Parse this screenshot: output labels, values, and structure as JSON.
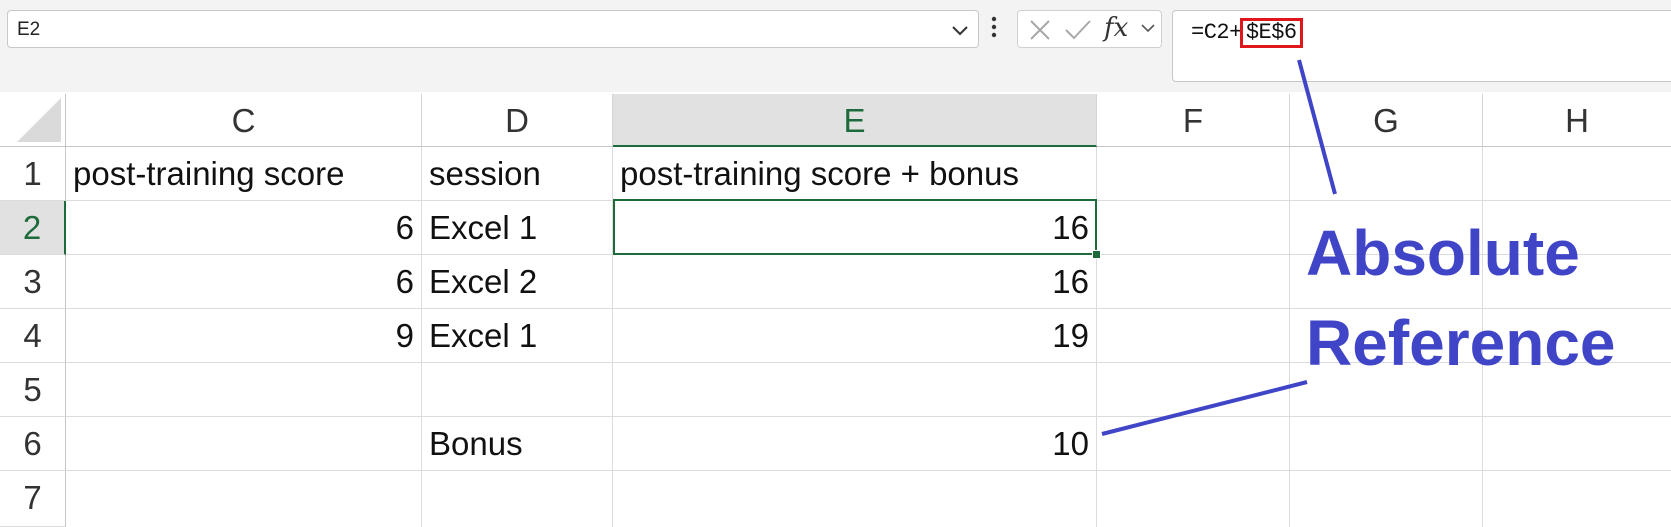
{
  "name_box": {
    "value": "E2"
  },
  "formula_bar": {
    "prefix": "=C2+",
    "highlighted_ref": "$E$6",
    "fx_label": "fx"
  },
  "columns": [
    "C",
    "D",
    "E",
    "F",
    "G",
    "H"
  ],
  "selected_column": "E",
  "rows": [
    "1",
    "2",
    "3",
    "4",
    "5",
    "6",
    "7"
  ],
  "selected_row": "2",
  "cells": {
    "C1": "post-training score",
    "D1": "session",
    "E1": "post-training score + bonus",
    "C2": "6",
    "D2": "Excel 1",
    "E2": "16",
    "C3": "6",
    "D3": "Excel 2",
    "E3": "16",
    "C4": "9",
    "D4": "Excel 1",
    "E4": "19",
    "D6": "Bonus",
    "E6": "10"
  },
  "annotation": {
    "line1": "Absolute",
    "line2": "Reference",
    "color": "#4045c8",
    "highlight_color": "#e0161d"
  },
  "colors": {
    "selection": "#1d6b3b"
  },
  "icons": {
    "name_box_dropdown": "chevron-down-icon",
    "more": "more-vertical-icon",
    "cancel": "close-icon",
    "enter": "check-icon",
    "insert_function": "function-icon"
  }
}
